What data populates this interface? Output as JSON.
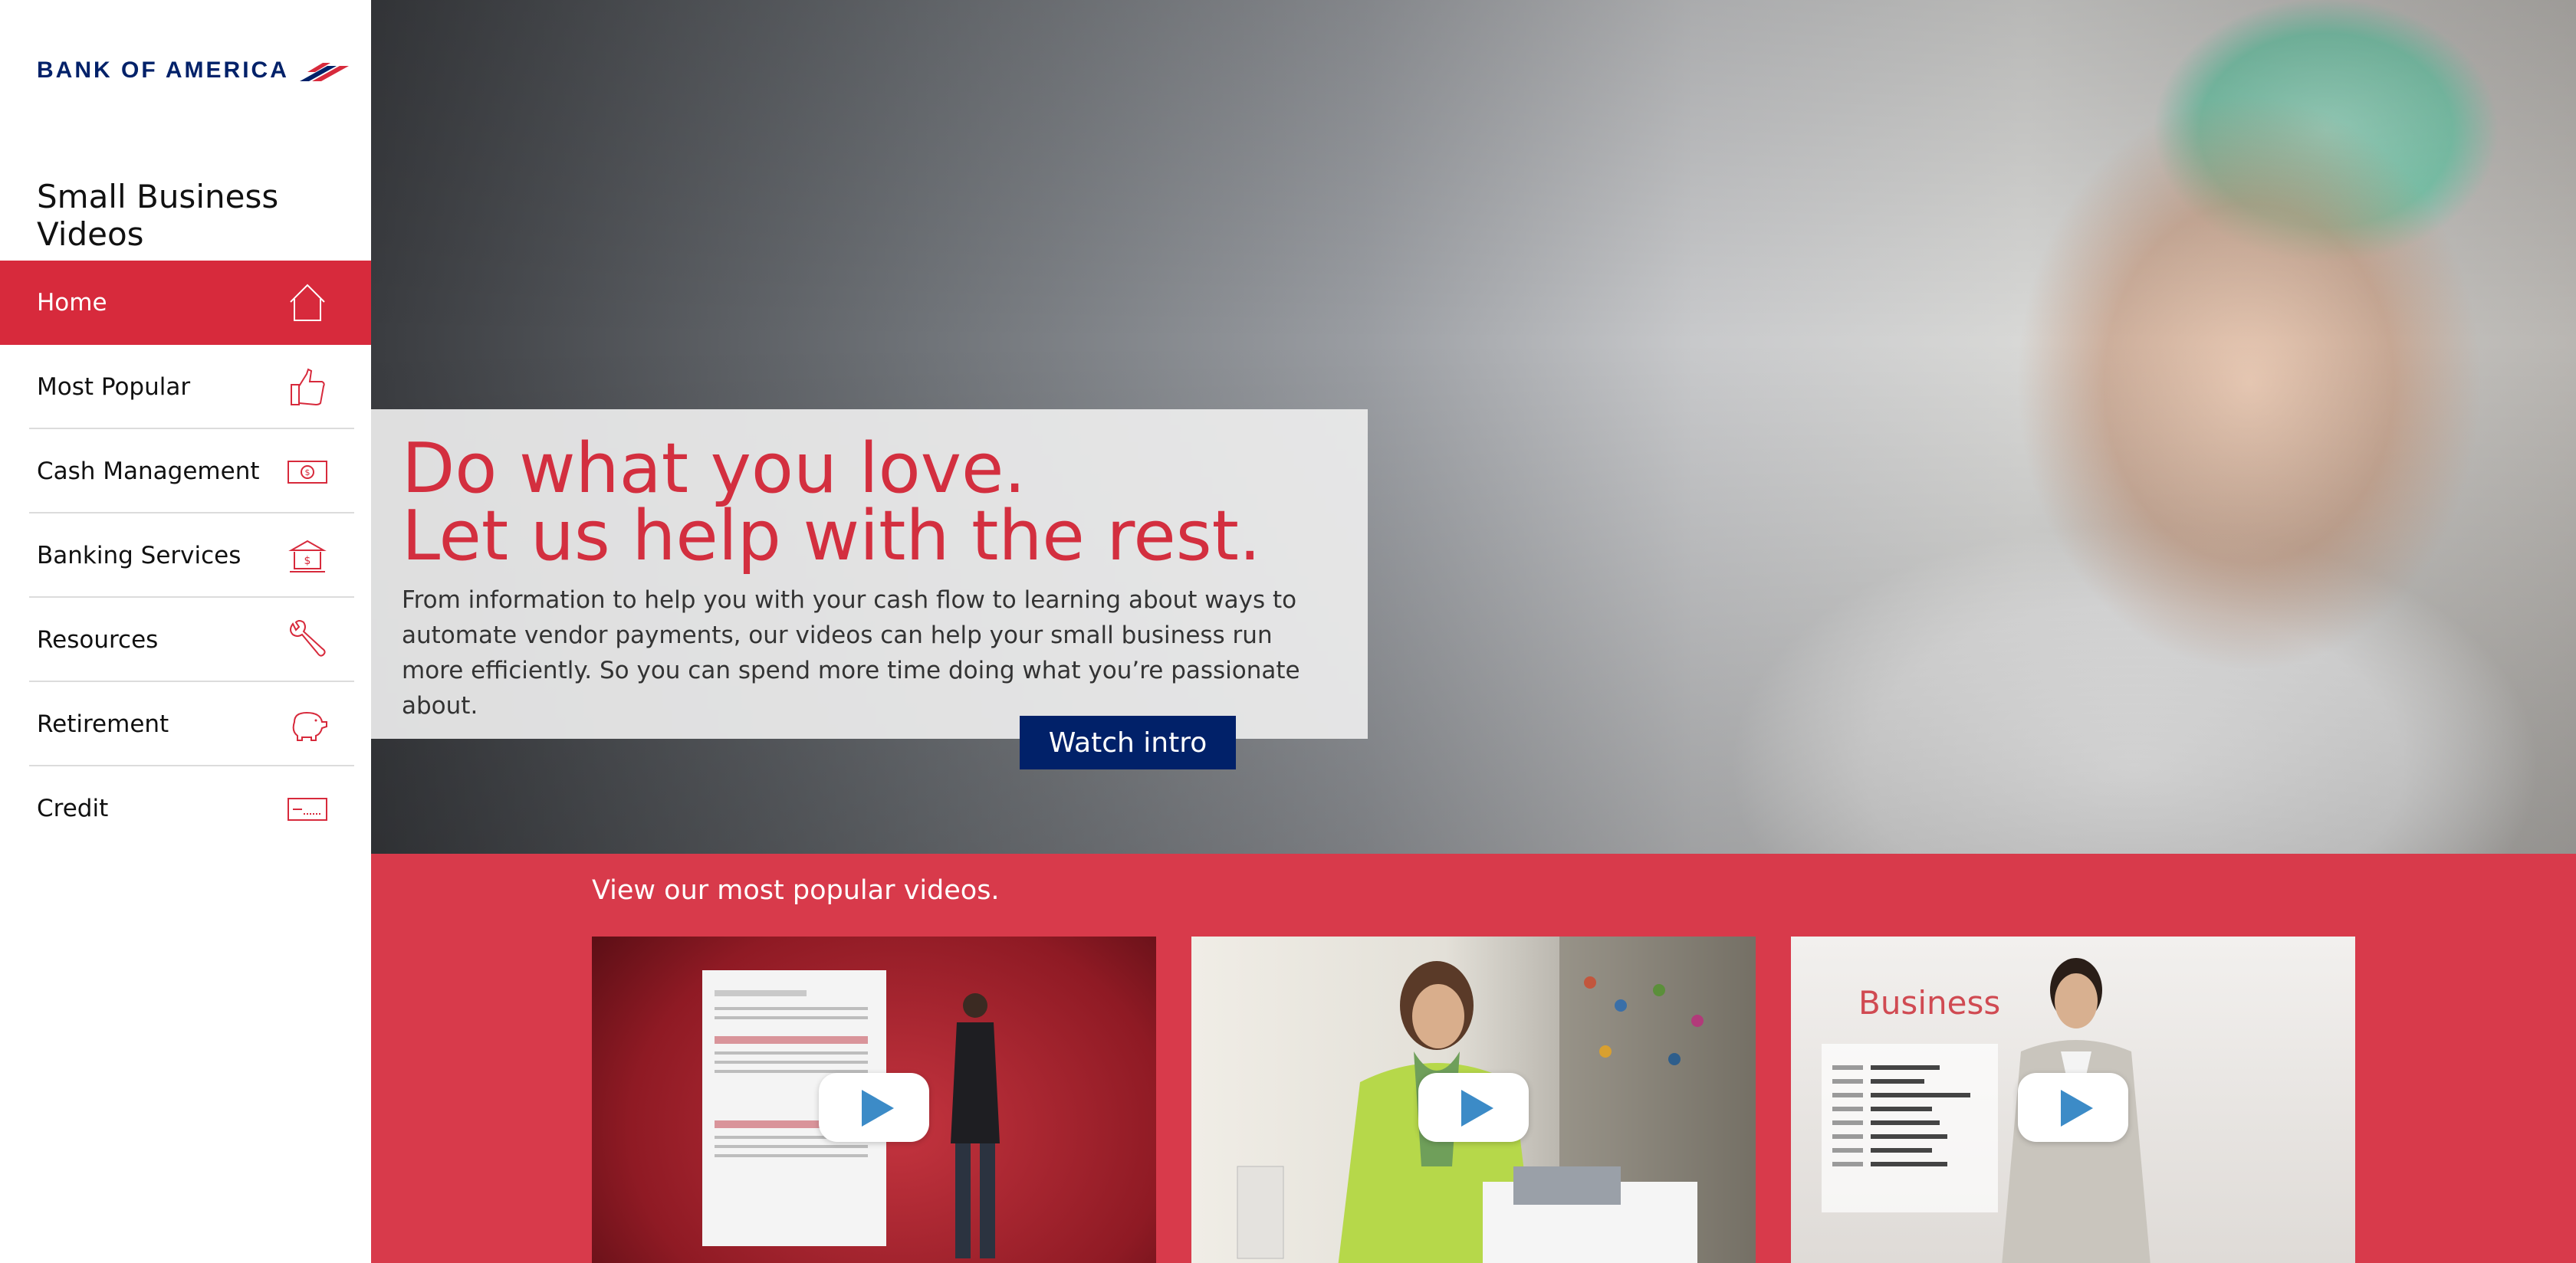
{
  "brand": {
    "name": "BANK OF AMERICA",
    "primary_color": "#012169",
    "accent_color": "#d72a3c"
  },
  "sidebar": {
    "title": "Small Business Videos",
    "items": [
      {
        "label": "Home",
        "icon": "home-icon",
        "active": true
      },
      {
        "label": "Most Popular",
        "icon": "thumbs-up-icon",
        "active": false
      },
      {
        "label": "Cash Management",
        "icon": "money-bill-icon",
        "active": false
      },
      {
        "label": "Banking Services",
        "icon": "bank-building-icon",
        "active": false
      },
      {
        "label": "Resources",
        "icon": "wrench-icon",
        "active": false
      },
      {
        "label": "Retirement",
        "icon": "piggy-bank-icon",
        "active": false
      },
      {
        "label": "Credit",
        "icon": "credit-card-icon",
        "active": false
      }
    ]
  },
  "hero": {
    "headline_line1": "Do what you love.",
    "headline_line2": "Let us help with the rest.",
    "body": "From information to help you with your cash flow to learning about ways to automate vendor payments, our videos can help your small business run more efficiently. So you can spend more time doing what you’re passionate about.",
    "cta_label": "Watch intro"
  },
  "popular": {
    "title": "View our most popular videos.",
    "thumb3_caption": "Business"
  }
}
